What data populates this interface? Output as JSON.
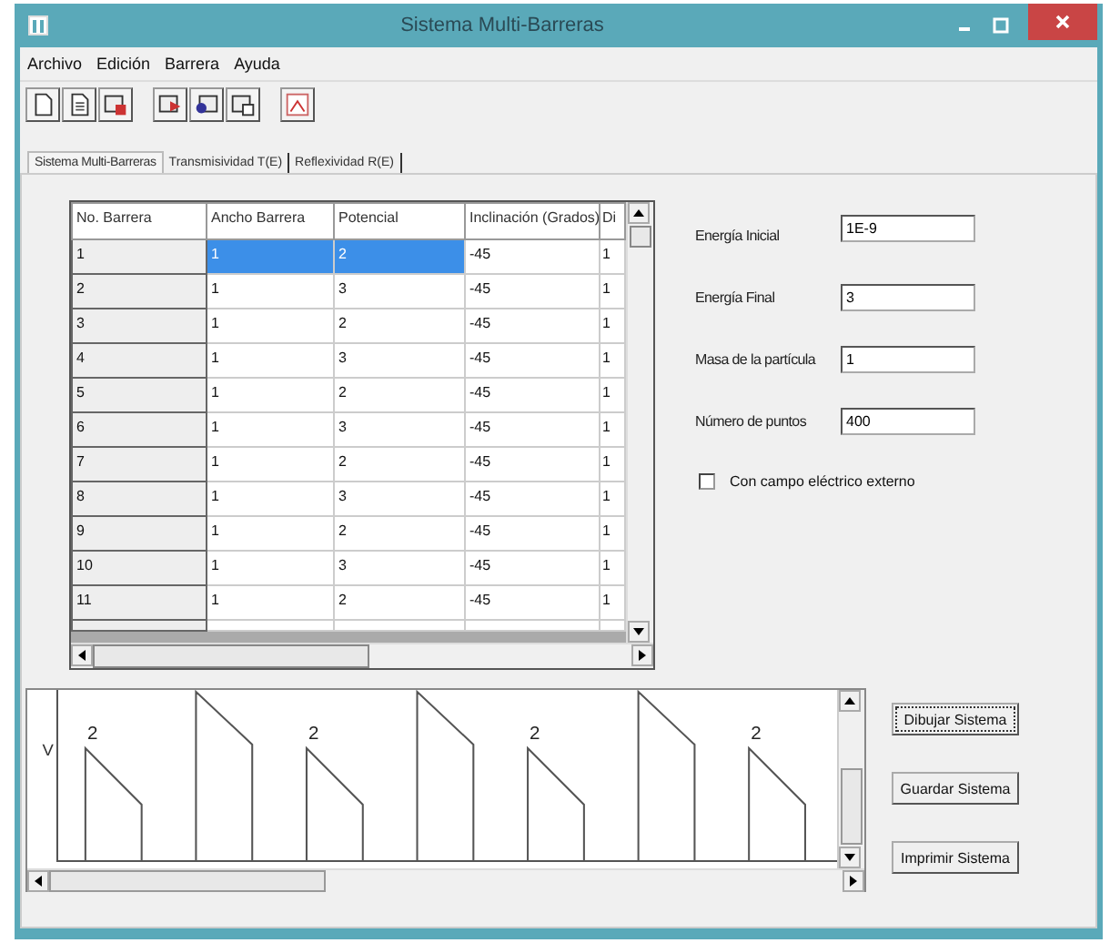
{
  "window": {
    "title": "Sistema Multi-Barreras"
  },
  "menu": [
    "Archivo",
    "Edición",
    "Barrera",
    "Ayuda"
  ],
  "tabs": [
    {
      "label": "Sistema Multi-Barreras",
      "selected": true
    },
    {
      "label": "Transmisividad  T(E)",
      "selected": false
    },
    {
      "label": "Reflexividad  R(E)",
      "selected": false
    }
  ],
  "table": {
    "columns": [
      "No. Barrera",
      "Ancho Barrera",
      "Potencial",
      "Inclinación (Grados)",
      "Di"
    ],
    "rows": [
      {
        "cells": [
          {
            "text": "1",
            "selected": false
          },
          {
            "text": "1",
            "selected": true
          },
          {
            "text": "2",
            "selected": true
          },
          {
            "text": "-45",
            "selected": false
          },
          {
            "text": "1",
            "selected": false
          }
        ]
      },
      {
        "cells": [
          {
            "text": "2",
            "selected": false
          },
          {
            "text": "1",
            "selected": false
          },
          {
            "text": "3",
            "selected": false
          },
          {
            "text": "-45",
            "selected": false
          },
          {
            "text": "1",
            "selected": false
          }
        ]
      },
      {
        "cells": [
          {
            "text": "3",
            "selected": false
          },
          {
            "text": "1",
            "selected": false
          },
          {
            "text": "2",
            "selected": false
          },
          {
            "text": "-45",
            "selected": false
          },
          {
            "text": "1",
            "selected": false
          }
        ]
      },
      {
        "cells": [
          {
            "text": "4",
            "selected": false
          },
          {
            "text": "1",
            "selected": false
          },
          {
            "text": "3",
            "selected": false
          },
          {
            "text": "-45",
            "selected": false
          },
          {
            "text": "1",
            "selected": false
          }
        ]
      },
      {
        "cells": [
          {
            "text": "5",
            "selected": false
          },
          {
            "text": "1",
            "selected": false
          },
          {
            "text": "2",
            "selected": false
          },
          {
            "text": "-45",
            "selected": false
          },
          {
            "text": "1",
            "selected": false
          }
        ]
      },
      {
        "cells": [
          {
            "text": "6",
            "selected": false
          },
          {
            "text": "1",
            "selected": false
          },
          {
            "text": "3",
            "selected": false
          },
          {
            "text": "-45",
            "selected": false
          },
          {
            "text": "1",
            "selected": false
          }
        ]
      },
      {
        "cells": [
          {
            "text": "7",
            "selected": false
          },
          {
            "text": "1",
            "selected": false
          },
          {
            "text": "2",
            "selected": false
          },
          {
            "text": "-45",
            "selected": false
          },
          {
            "text": "1",
            "selected": false
          }
        ]
      },
      {
        "cells": [
          {
            "text": "8",
            "selected": false
          },
          {
            "text": "1",
            "selected": false
          },
          {
            "text": "3",
            "selected": false
          },
          {
            "text": "-45",
            "selected": false
          },
          {
            "text": "1",
            "selected": false
          }
        ]
      },
      {
        "cells": [
          {
            "text": "9",
            "selected": false
          },
          {
            "text": "1",
            "selected": false
          },
          {
            "text": "2",
            "selected": false
          },
          {
            "text": "-45",
            "selected": false
          },
          {
            "text": "1",
            "selected": false
          }
        ]
      },
      {
        "cells": [
          {
            "text": "10",
            "selected": false
          },
          {
            "text": "1",
            "selected": false
          },
          {
            "text": "3",
            "selected": false
          },
          {
            "text": "-45",
            "selected": false
          },
          {
            "text": "1",
            "selected": false
          }
        ]
      },
      {
        "cells": [
          {
            "text": "11",
            "selected": false
          },
          {
            "text": "1",
            "selected": false
          },
          {
            "text": "2",
            "selected": false
          },
          {
            "text": "-45",
            "selected": false
          },
          {
            "text": "1",
            "selected": false
          }
        ]
      }
    ]
  },
  "fields": [
    {
      "label": "Energía Inicial",
      "value": "1E-9"
    },
    {
      "label": "Energía Final",
      "value": "3"
    },
    {
      "label": "Masa de la partícula",
      "value": "1"
    },
    {
      "label": "Número de puntos",
      "value": "400"
    }
  ],
  "checkbox": {
    "label": "Con campo eléctrico externo",
    "checked": false
  },
  "plot": {
    "axis_label": "V",
    "barrier_labels": [
      "2",
      "2",
      "2",
      "2"
    ]
  },
  "buttons": [
    {
      "label": "Dibujar Sistema",
      "focused": true
    },
    {
      "label": "Guardar Sistema",
      "focused": false
    },
    {
      "label": "Imprimir Sistema",
      "focused": false
    }
  ]
}
